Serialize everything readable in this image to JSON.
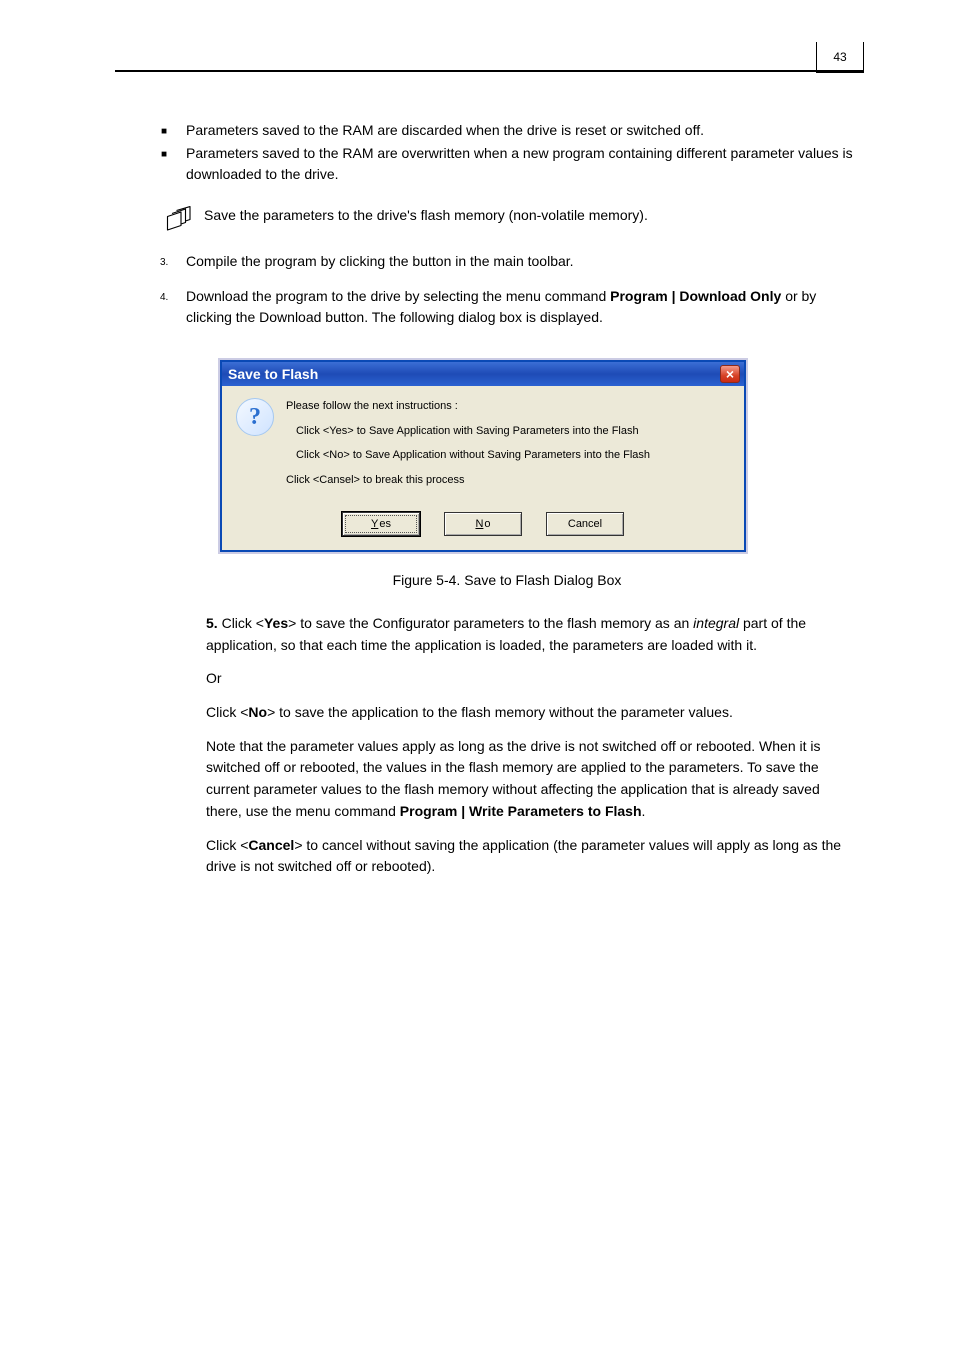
{
  "page_number": "43",
  "bullets": {
    "b1a": "Parameters saved to the RAM are discarded when the drive is reset or switched off.",
    "b1b": "Parameters saved to the RAM are overwritten when a new program containing different parameter values is downloaded to the drive.",
    "note": "Save the parameters to the drive's flash memory (non-volatile memory)."
  },
  "steps": {
    "s3": {
      "num": "3.",
      "text": "Compile the program by clicking the button in the main toolbar."
    },
    "s4": {
      "num": "4.",
      "label": "",
      "text_parts": [
        "Download the program to the drive by selecting the menu command",
        "Program | Download Only",
        "or by clicking the Download button. The following dialog box is displayed."
      ]
    }
  },
  "dialog": {
    "title": "Save to Flash",
    "line1": "Please follow the next instructions :",
    "line2": "Click <Yes> to Save Application with    Saving Parameters into the Flash",
    "line3": "Click <No>  to Save Application without Saving Parameters into the Flash",
    "line4": "Click <Cansel> to break this process",
    "buttons": {
      "yes_access": "Y",
      "yes_rest": "es",
      "no_access": "N",
      "no_rest": "o",
      "cancel": "Cancel"
    }
  },
  "figure_caption": "Figure 5-4. Save to Flash Dialog Box",
  "after": {
    "p5_num": "5.",
    "p5_text_a": "Click <",
    "p5_yes": "Yes",
    "p5_text_b": "> to save the Configurator parameters to the flash memory as an ",
    "p5_integral": "integral",
    "p5_text_c": " part of the application, so that each time the application is loaded, the parameters are loaded with it.",
    "p_or": "Or",
    "p_no_a": "Click <",
    "p_no": "No",
    "p_no_b": "> to save the application to the flash memory without the parameter values.",
    "p_note": "Note that the parameter values apply as long as the drive is not switched off or rebooted. When it is switched off or rebooted, the values in the flash memory are applied to the parameters. To save the current parameter values to the flash memory without affecting the application that is already saved there, use the menu command ",
    "p_note_menu": "Program | Write Parameters to Flash",
    "p_note_end": ".",
    "p_cancel_a": "Click <",
    "p_cancel": "Cancel",
    "p_cancel_b": "> to cancel without saving the application (the parameter values will apply as long as the drive is not switched off or rebooted)."
  },
  "footer": ""
}
